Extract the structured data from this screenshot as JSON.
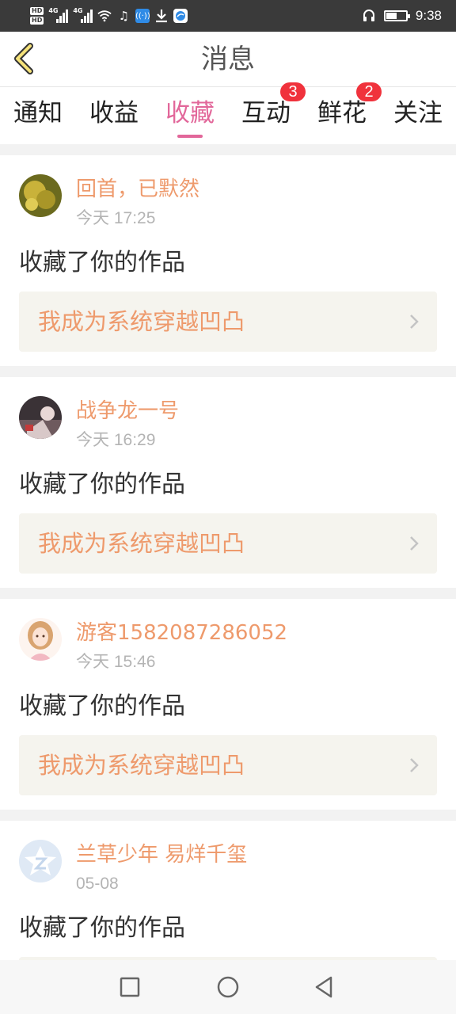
{
  "status_bar": {
    "hd_labels": [
      "HD",
      "HD"
    ],
    "network_labels": [
      "4G",
      "4G"
    ],
    "time": "9:38",
    "icons": [
      "wifi-icon",
      "music-icon",
      "app-icon",
      "download-icon",
      "browser-icon",
      "headset-icon",
      "battery-icon"
    ],
    "battery_level": 0.55
  },
  "header": {
    "title": "消息"
  },
  "tabs": [
    {
      "label": "通知",
      "active": false,
      "badge": ""
    },
    {
      "label": "收益",
      "active": false,
      "badge": ""
    },
    {
      "label": "收藏",
      "active": true,
      "badge": ""
    },
    {
      "label": "互动",
      "active": false,
      "badge": "3"
    },
    {
      "label": "鲜花",
      "active": false,
      "badge": "2"
    },
    {
      "label": "关注",
      "active": false,
      "badge": ""
    }
  ],
  "items": [
    {
      "user": "回首，已默然",
      "time": "今天 17:25",
      "action": "收藏了你的作品",
      "work_title": "我成为系统穿越凹凸",
      "avatar": "avatar-photo-1"
    },
    {
      "user": "战争龙一号",
      "time": "今天 16:29",
      "action": "收藏了你的作品",
      "work_title": "我成为系统穿越凹凸",
      "avatar": "avatar-photo-2"
    },
    {
      "user": "游客1582087286052",
      "time": "今天 15:46",
      "action": "收藏了你的作品",
      "work_title": "我成为系统穿越凹凸",
      "avatar": "avatar-photo-3"
    },
    {
      "user": "兰草少年 易烊千玺",
      "time": "05-08",
      "action": "收藏了你的作品",
      "work_title": "",
      "avatar": "avatar-default"
    }
  ],
  "colors": {
    "accent": "#e2679a",
    "username": "#ee9a6c",
    "badge": "#f0323c",
    "work_bg": "#f5f4ee",
    "statusbar": "#3a3a3a"
  },
  "nav": {
    "icons": [
      "recent-apps-icon",
      "home-icon",
      "back-nav-icon"
    ]
  }
}
